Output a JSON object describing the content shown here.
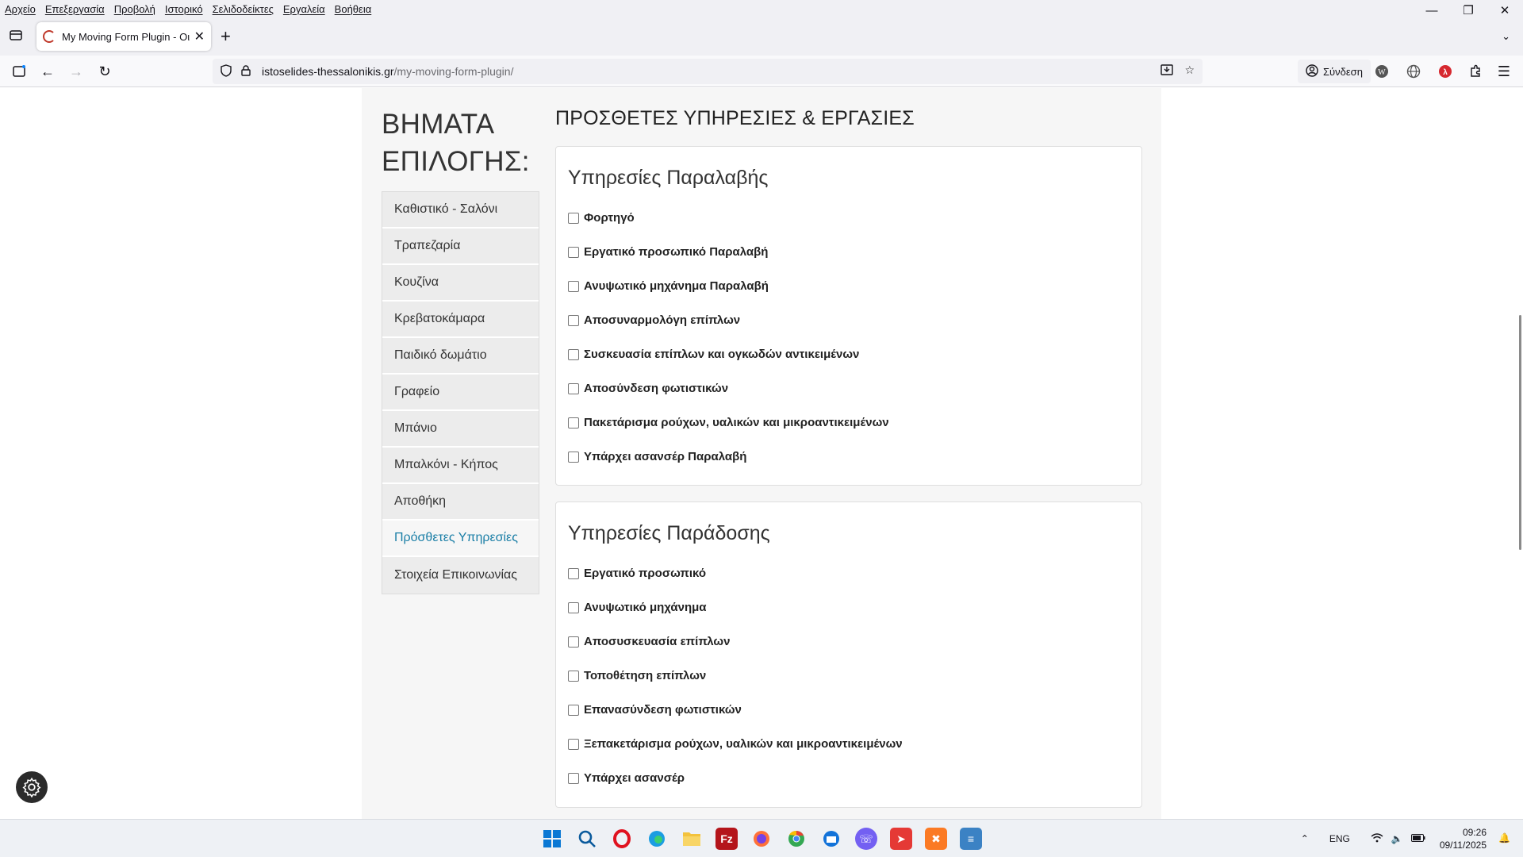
{
  "browser": {
    "menu": [
      "Αρχείο",
      "Επεξεργασία",
      "Προβολή",
      "Ιστορικό",
      "Σελιδοδείκτες",
      "Εργαλεία",
      "Βοήθεια"
    ],
    "tab_title": "My Moving Form Plugin - Οικι",
    "url_host": "istoselides-thessalonikis.gr",
    "url_path": "/my-moving-form-plugin/",
    "signin_label": "Σύνδεση"
  },
  "sidebar": {
    "title_line1": "ΒΗΜΑΤΑ",
    "title_line2": "ΕΠΙΛΟΓΗΣ:",
    "steps": [
      {
        "label": "Καθιστικό - Σαλόνι"
      },
      {
        "label": "Τραπεζαρία"
      },
      {
        "label": "Κουζίνα"
      },
      {
        "label": "Κρεβατοκάμαρα"
      },
      {
        "label": "Παιδικό δωμάτιο"
      },
      {
        "label": "Γραφείο"
      },
      {
        "label": "Μπάνιο"
      },
      {
        "label": "Μπαλκόνι - Κήπος"
      },
      {
        "label": "Αποθήκη"
      },
      {
        "label": "Πρόσθετες Υπηρεσίες",
        "active": true
      },
      {
        "label": "Στοιχεία Επικοινωνίας"
      }
    ]
  },
  "main": {
    "section_title": "ΠΡΟΣΘΕΤΕΣ ΥΠΗΡΕΣΙΕΣ & ΕΡΓΑΣΙΕΣ",
    "pickup": {
      "title": "Υπηρεσίες Παραλαβής",
      "options": [
        "Φορτηγό",
        "Εργατικό προσωπικό Παραλαβή",
        "Ανυψωτικό μηχάνημα Παραλαβή",
        "Αποσυναρμολόγη επίπλων",
        "Συσκευασία επίπλων και ογκωδών αντικειμένων",
        "Αποσύνδεση φωτιστικών",
        "Πακετάρισμα ρούχων, υαλικών και μικροαντικειμένων",
        "Υπάρχει ασανσέρ Παραλαβή"
      ]
    },
    "delivery": {
      "title": "Υπηρεσίες Παράδοσης",
      "options": [
        "Εργατικό προσωπικό",
        "Ανυψωτικό μηχάνημα",
        "Αποσυσκευασία επίπλων",
        "Τοποθέτηση επίπλων",
        "Επανασύνδεση φωτιστικών",
        "Ξεπακετάρισμα ρούχων, υαλικών και μικροαντικειμένων",
        "Υπάρχει ασανσέρ"
      ]
    }
  },
  "taskbar": {
    "lang": "ENG",
    "time": "09:26",
    "date": "09/11/2025"
  }
}
